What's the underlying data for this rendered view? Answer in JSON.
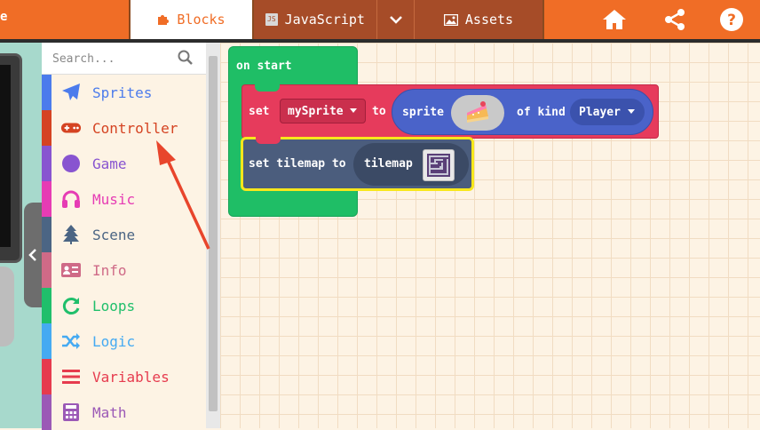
{
  "topbar": {
    "edge_glyph": "e",
    "tabs": [
      {
        "label": "Blocks",
        "icon": "puzzle-icon"
      },
      {
        "label": "JavaScript",
        "icon": "js-file-icon",
        "badge": "JS"
      },
      {
        "label": "",
        "icon": "chevron-down-icon"
      },
      {
        "label": "Assets",
        "icon": "image-icon"
      }
    ],
    "icons": [
      "home-icon",
      "share-icon",
      "help-icon"
    ],
    "colors": {
      "bar": "#f06d26",
      "tab_inactive": "#a64c28",
      "tab_active_text": "#f06d26"
    }
  },
  "toolbox": {
    "search_placeholder": "Search...",
    "categories": [
      {
        "label": "Sprites",
        "color": "#4b7bec",
        "icon": "paper-plane-icon"
      },
      {
        "label": "Controller",
        "color": "#d54322",
        "icon": "gamepad-icon"
      },
      {
        "label": "Game",
        "color": "#8854d0",
        "icon": "circle-icon"
      },
      {
        "label": "Music",
        "color": "#e63cb4",
        "icon": "headphones-icon"
      },
      {
        "label": "Scene",
        "color": "#4b6584",
        "icon": "tree-icon"
      },
      {
        "label": "Info",
        "color": "#cf6a87",
        "icon": "id-card-icon"
      },
      {
        "label": "Loops",
        "color": "#20bf6b",
        "icon": "refresh-icon"
      },
      {
        "label": "Logic",
        "color": "#45aaf2",
        "icon": "shuffle-icon"
      },
      {
        "label": "Variables",
        "color": "#e63b4e",
        "icon": "list-icon"
      },
      {
        "label": "Math",
        "color": "#9b59b6",
        "icon": "calculator-icon"
      }
    ]
  },
  "workspace": {
    "on_start": "on start",
    "set_label": "set",
    "variable": "mySprite",
    "to_label": "to",
    "sprite_label": "sprite",
    "sprite_image": "cake-icon",
    "of_kind_label": "of kind",
    "kind": "Player",
    "set_tilemap_label": "set tilemap to",
    "tilemap_label": "tilemap",
    "tilemap_image": "maze-icon",
    "colors": {
      "on_start": "#1fbe66",
      "set": "#e63b5c",
      "sprite": "#4a63c9",
      "tilemap": "#4b5d7d",
      "highlight": "#f8e71c"
    }
  },
  "annotation": {
    "target": "Controller",
    "arrow_color": "#e8452c"
  }
}
